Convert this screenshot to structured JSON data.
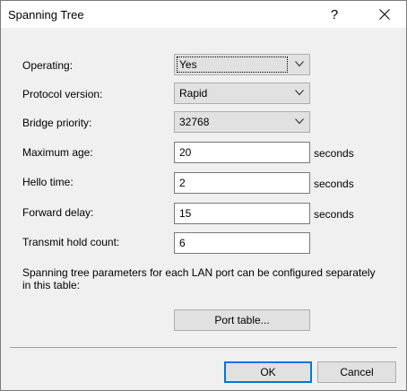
{
  "window": {
    "title": "Spanning Tree",
    "help_label": "?"
  },
  "fields": {
    "operating": {
      "label": "Operating:",
      "value": "Yes"
    },
    "protocol_version": {
      "label": "Protocol version:",
      "value": "Rapid"
    },
    "bridge_priority": {
      "label": "Bridge priority:",
      "value": "32768"
    },
    "maximum_age": {
      "label": "Maximum age:",
      "value": "20",
      "unit": "seconds"
    },
    "hello_time": {
      "label": "Hello time:",
      "value": "2",
      "unit": "seconds"
    },
    "forward_delay": {
      "label": "Forward delay:",
      "value": "15",
      "unit": "seconds"
    },
    "transmit_hold_count": {
      "label": "Transmit hold count:",
      "value": "6"
    }
  },
  "info_text": "Spanning tree parameters for each LAN port can be configured separately in this table:",
  "buttons": {
    "port_table": "Port table...",
    "ok": "OK",
    "cancel": "Cancel"
  },
  "colors": {
    "accent": "#0078d7",
    "dialog_bg": "#f0f0f0"
  }
}
